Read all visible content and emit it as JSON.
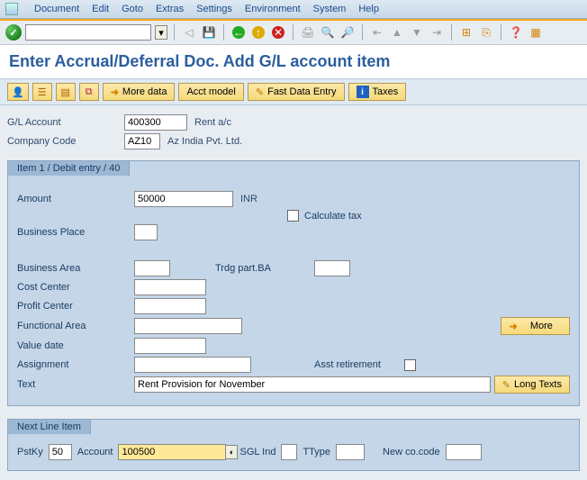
{
  "menu": {
    "items": [
      "Document",
      "Edit",
      "Goto",
      "Extras",
      "Settings",
      "Environment",
      "System",
      "Help"
    ]
  },
  "title": "Enter Accrual/Deferral Doc. Add G/L account item",
  "app_toolbar": {
    "more_data": "More data",
    "acct_model": "Acct model",
    "fast_entry": "Fast Data Entry",
    "taxes": "Taxes"
  },
  "header": {
    "gl_account_label": "G/L Account",
    "gl_account_value": "400300",
    "gl_account_desc": "Rent a/c",
    "company_code_label": "Company Code",
    "company_code_value": "AZ10",
    "company_code_desc": "Az India Pvt. Ltd."
  },
  "item_panel": {
    "title": "Item 1 / Debit entry / 40",
    "amount_label": "Amount",
    "amount_value": "50000",
    "currency": "INR",
    "calc_tax_label": "Calculate tax",
    "business_place_label": "Business Place",
    "business_area_label": "Business Area",
    "trdg_part_label": "Trdg part.BA",
    "cost_center_label": "Cost Center",
    "profit_center_label": "Profit Center",
    "functional_area_label": "Functional Area",
    "more_label": "More",
    "value_date_label": "Value date",
    "assignment_label": "Assignment",
    "asst_retirement_label": "Asst retirement",
    "text_label": "Text",
    "text_value": "Rent Provision for November",
    "long_texts_label": "Long Texts"
  },
  "next_line": {
    "title": "Next Line Item",
    "pstky_label": "PstKy",
    "pstky_value": "50",
    "account_label": "Account",
    "account_value": "100500",
    "sgl_label": "SGL Ind",
    "ttype_label": "TType",
    "new_cocode_label": "New co.code"
  }
}
